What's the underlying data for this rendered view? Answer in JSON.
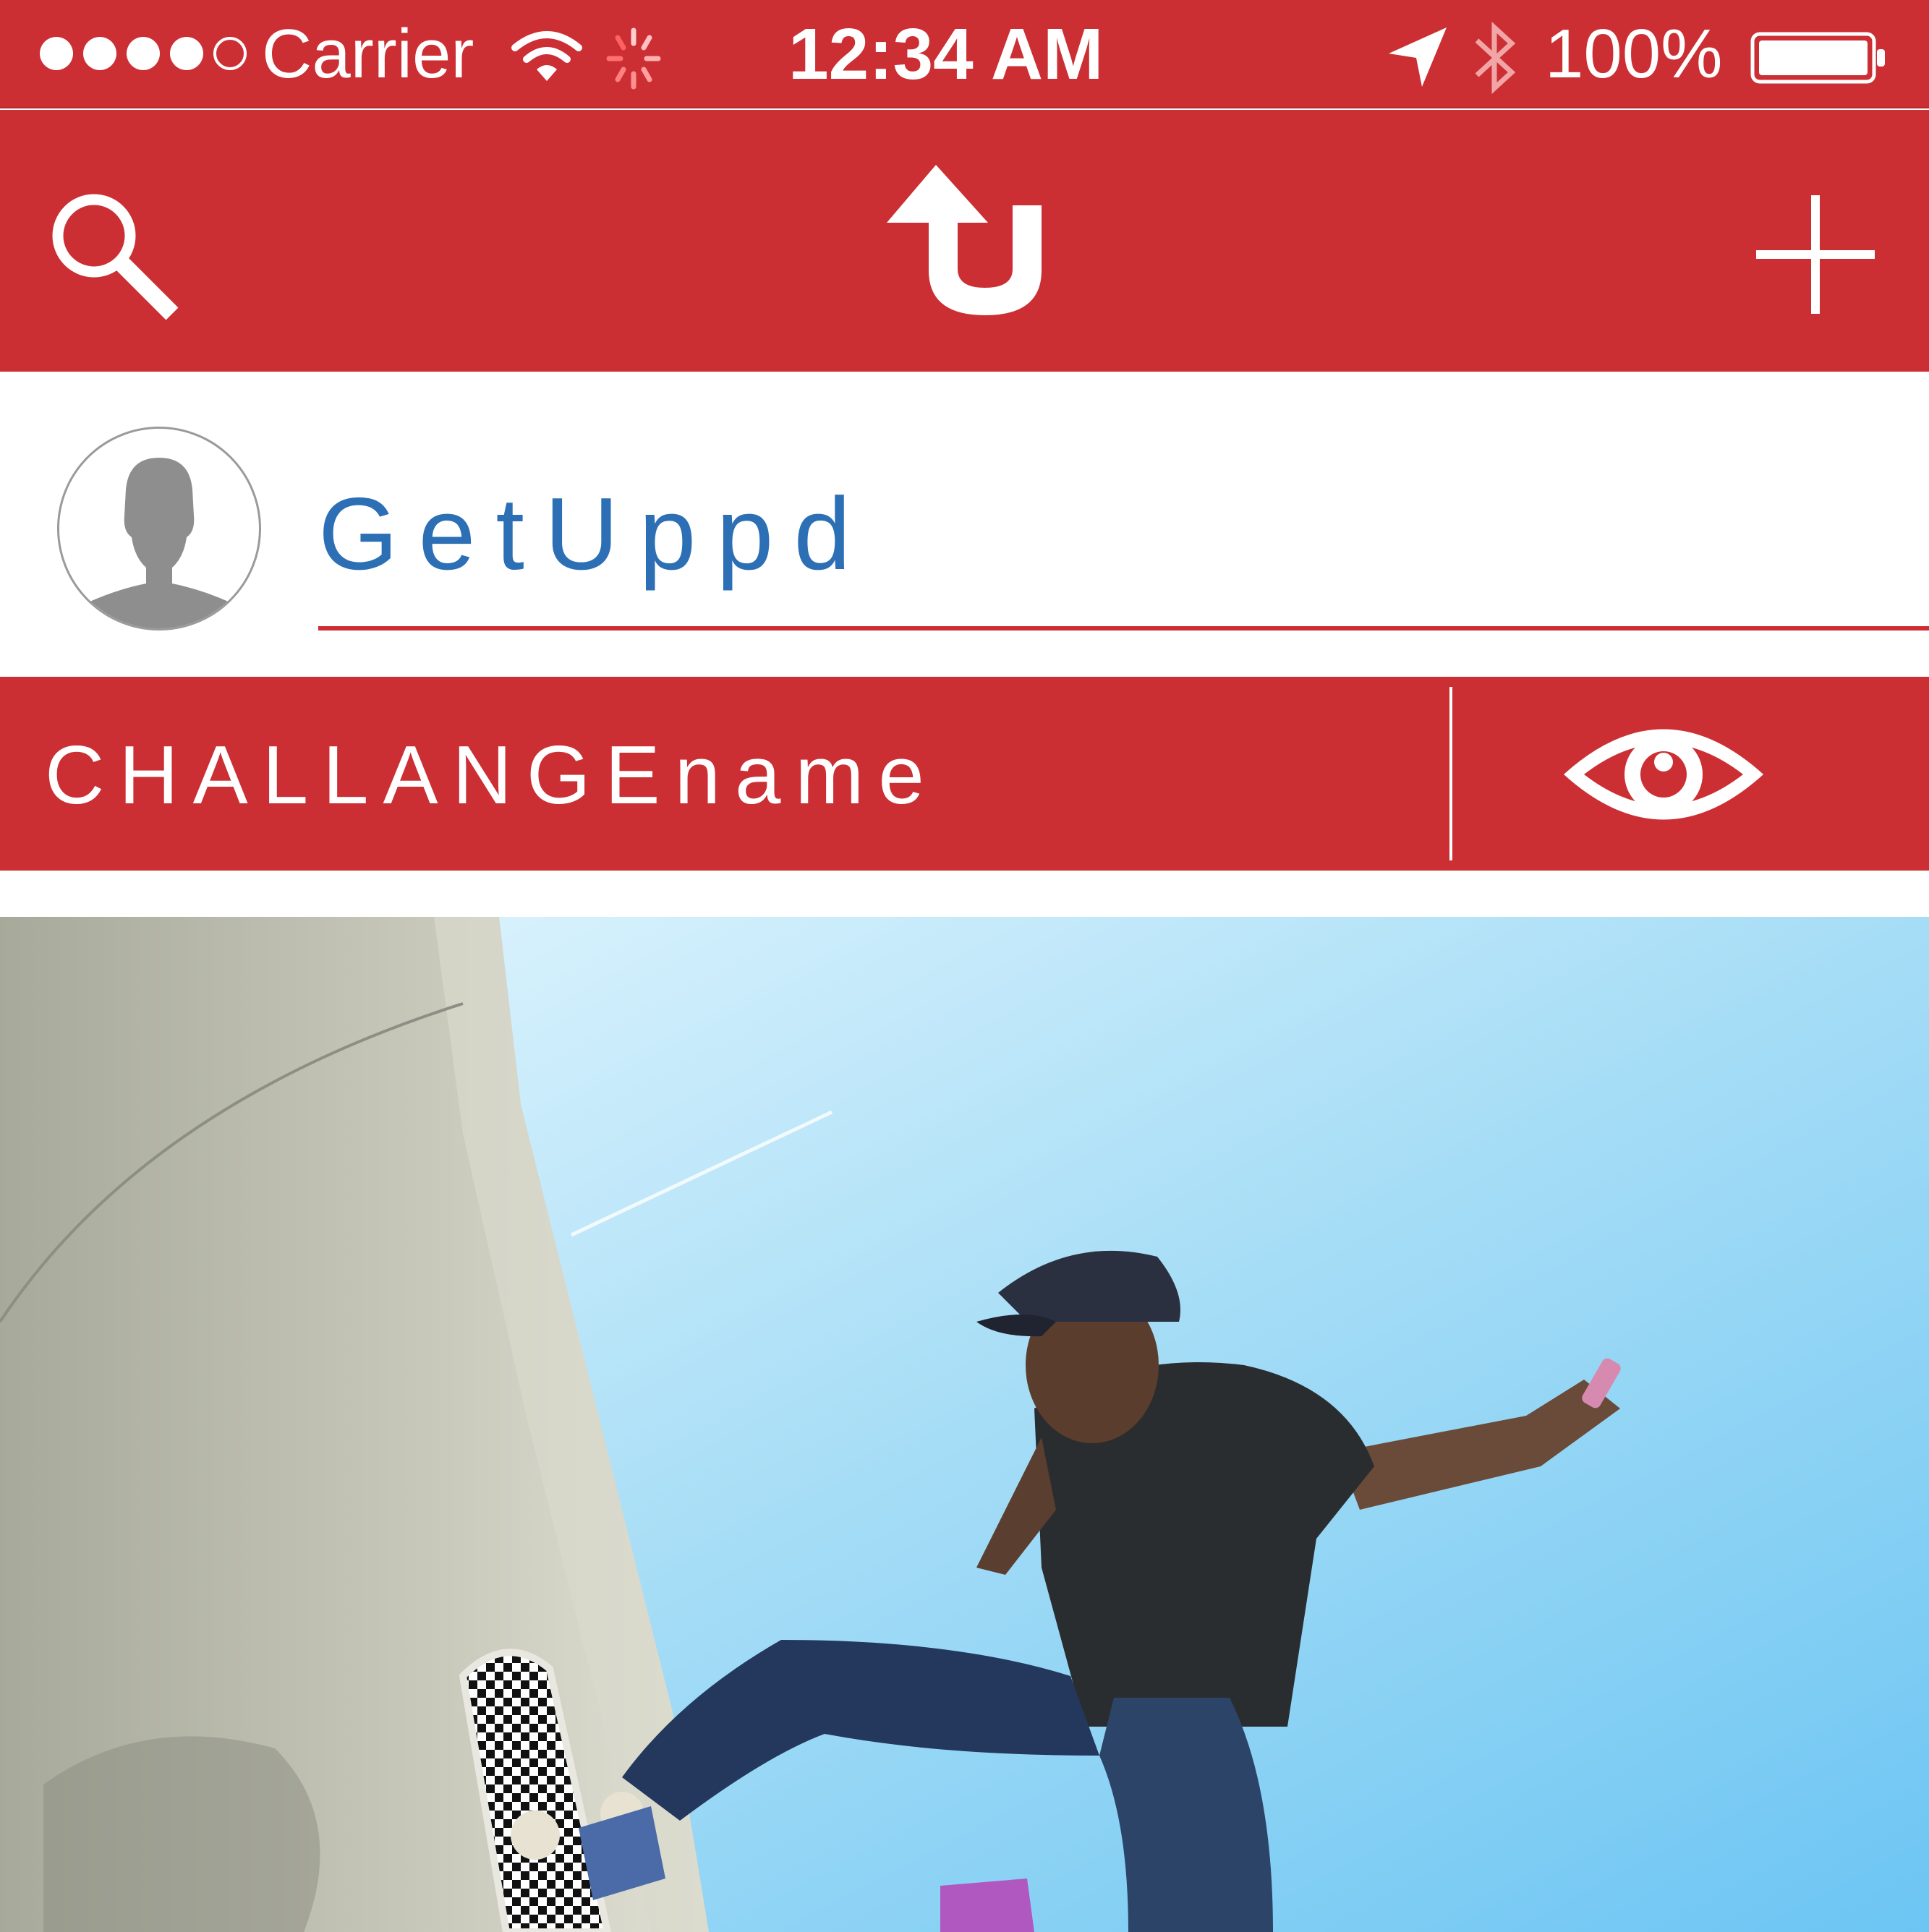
{
  "status_bar": {
    "signal_dots_filled": 4,
    "signal_dots_total": 5,
    "carrier": "Carrier",
    "time": "12:34 AM",
    "battery_percent": "100%",
    "battery_level": 1.0,
    "icons": [
      "signal-icon",
      "wifi-icon",
      "activity-spinner-icon",
      "location-arrow-icon",
      "bluetooth-icon",
      "battery-icon"
    ]
  },
  "nav_bar": {
    "icons": [
      "search-icon",
      "app-logo-icon",
      "add-icon"
    ]
  },
  "post": {
    "username": "GetUppd",
    "avatar_icon": "default-avatar-icon",
    "challenge_name": "CHALLANGEname",
    "view_icon": "eye-icon",
    "photo_subject": "skateboarder-photo"
  },
  "colors": {
    "brand_red": "#cc2f33",
    "username_blue": "#2c6fb5",
    "white": "#ffffff"
  }
}
